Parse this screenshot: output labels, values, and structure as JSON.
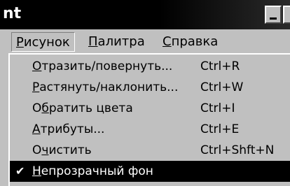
{
  "window": {
    "title": "nt"
  },
  "menubar": {
    "items": [
      {
        "pre": "",
        "ul": "Р",
        "post": "исунок"
      },
      {
        "pre": "",
        "ul": "П",
        "post": "алитра"
      },
      {
        "pre": "",
        "ul": "С",
        "post": "правка"
      }
    ]
  },
  "dropdown": {
    "items": [
      {
        "pre": "",
        "ul": "О",
        "post": "тразить/повернуть...",
        "shortcut": "Ctrl+R"
      },
      {
        "pre": "",
        "ul": "Р",
        "post": "астянуть/наклонить...",
        "shortcut": "Ctrl+W"
      },
      {
        "pre": "О",
        "ul": "б",
        "post": "ратить цвета",
        "shortcut": "Ctrl+I"
      },
      {
        "pre": "",
        "ul": "А",
        "post": "трибуты...",
        "shortcut": "Ctrl+E"
      },
      {
        "pre": "О",
        "ul": "ч",
        "post": "истить",
        "shortcut": "Ctrl+Shft+N"
      },
      {
        "pre": "",
        "ul": "Н",
        "post": "епрозрачный фон",
        "shortcut": "",
        "checked": true,
        "check": "✔"
      }
    ]
  },
  "colors": {
    "titlebar": "#000000",
    "face": "#c0c0c0",
    "highlight": "#000000",
    "highlight_text": "#ffffff"
  }
}
